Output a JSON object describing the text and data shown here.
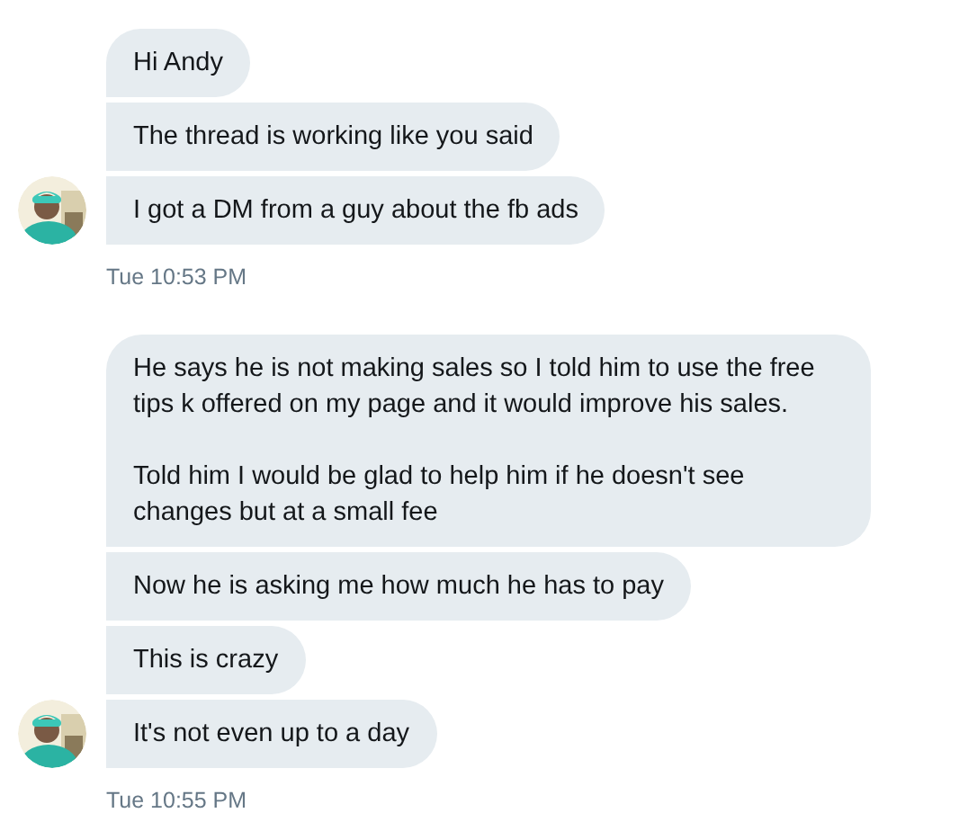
{
  "groups": [
    {
      "messages": [
        {
          "paragraphs": [
            "Hi Andy"
          ]
        },
        {
          "paragraphs": [
            "The thread is working like you said"
          ]
        },
        {
          "paragraphs": [
            "I got a DM from a guy about the fb ads"
          ]
        }
      ],
      "time": "Tue 10:53 PM"
    },
    {
      "messages": [
        {
          "paragraphs": [
            "He says he is not making sales so I told him to use the free tips k offered on my page and it would improve his sales.",
            "Told him I would be glad to help him if he doesn't see changes but at a small fee"
          ]
        },
        {
          "paragraphs": [
            "Now he is asking me how much he has to pay"
          ]
        },
        {
          "paragraphs": [
            "This is crazy"
          ]
        },
        {
          "paragraphs": [
            "It's not even up to a day"
          ]
        }
      ],
      "time": "Tue 10:55 PM"
    }
  ]
}
